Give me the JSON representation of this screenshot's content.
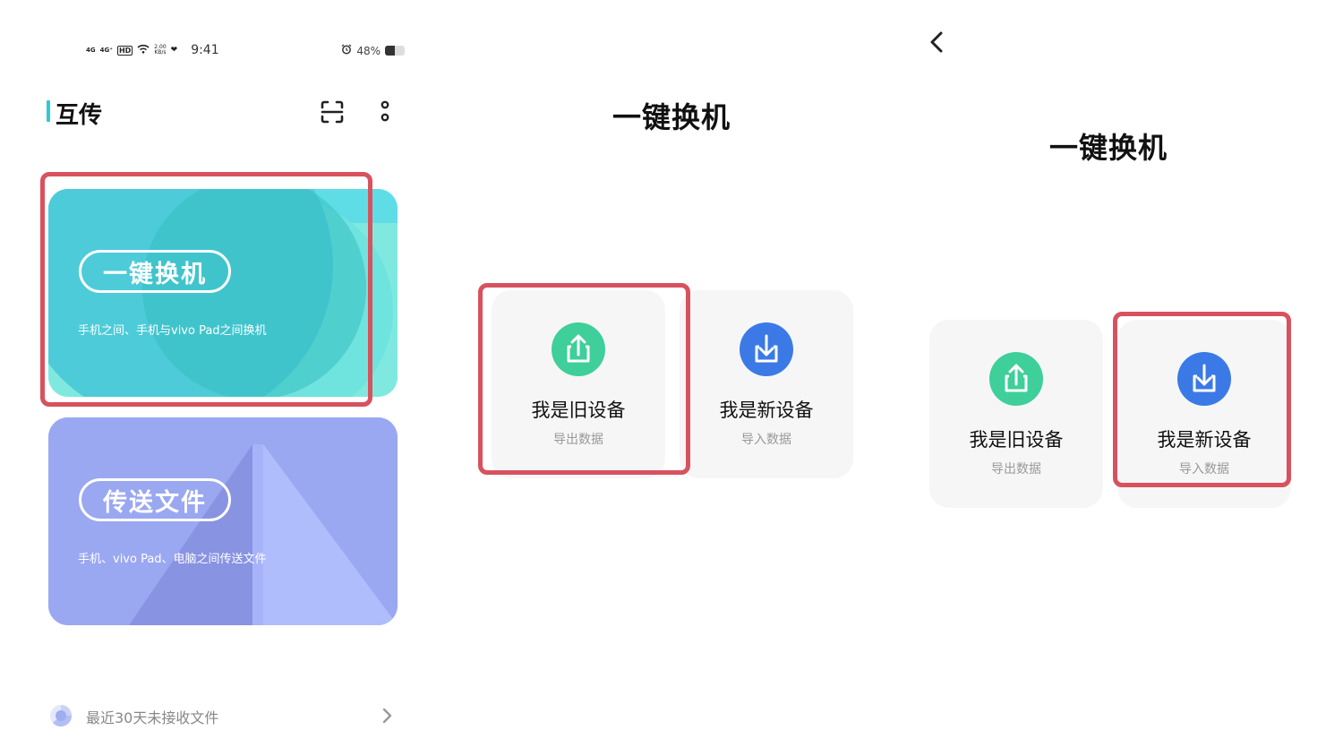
{
  "status_bar": {
    "signal_1": "4G",
    "signal_2": "4G⁺",
    "hd_badge": "HD",
    "net_speed_value": "2.00",
    "net_speed_unit": "KB/s",
    "time": "9:41",
    "battery_text": "48%",
    "battery_level": 0.48
  },
  "home_screen": {
    "title": "互传",
    "cards": [
      {
        "title": "一键换机",
        "subtitle": "手机之间、手机与vivo Pad之间换机"
      },
      {
        "title": "传送文件",
        "subtitle": "手机、vivo Pad、电脑之间传送文件"
      }
    ],
    "recent_files": {
      "label": "最近30天未接收文件"
    }
  },
  "switch_screen_a": {
    "title": "一键换机",
    "options": [
      {
        "label": "我是旧设备",
        "sub": "导出数据",
        "icon": "upload-icon",
        "color": "#3ecf9b"
      },
      {
        "label": "我是新设备",
        "sub": "导入数据",
        "icon": "download-icon",
        "color": "#3b7ae6"
      }
    ]
  },
  "switch_screen_b": {
    "title": "一键换机",
    "options": [
      {
        "label": "我是旧设备",
        "sub": "导出数据",
        "icon": "upload-icon",
        "color": "#3ecf9b"
      },
      {
        "label": "我是新设备",
        "sub": "导入数据",
        "icon": "download-icon",
        "color": "#3b7ae6"
      }
    ]
  },
  "colors": {
    "accent_teal": "#2ec9d6",
    "highlight": "#d8525e",
    "exchange_card": "#7fe9e0",
    "transfer_card": "#9aa8f2"
  }
}
